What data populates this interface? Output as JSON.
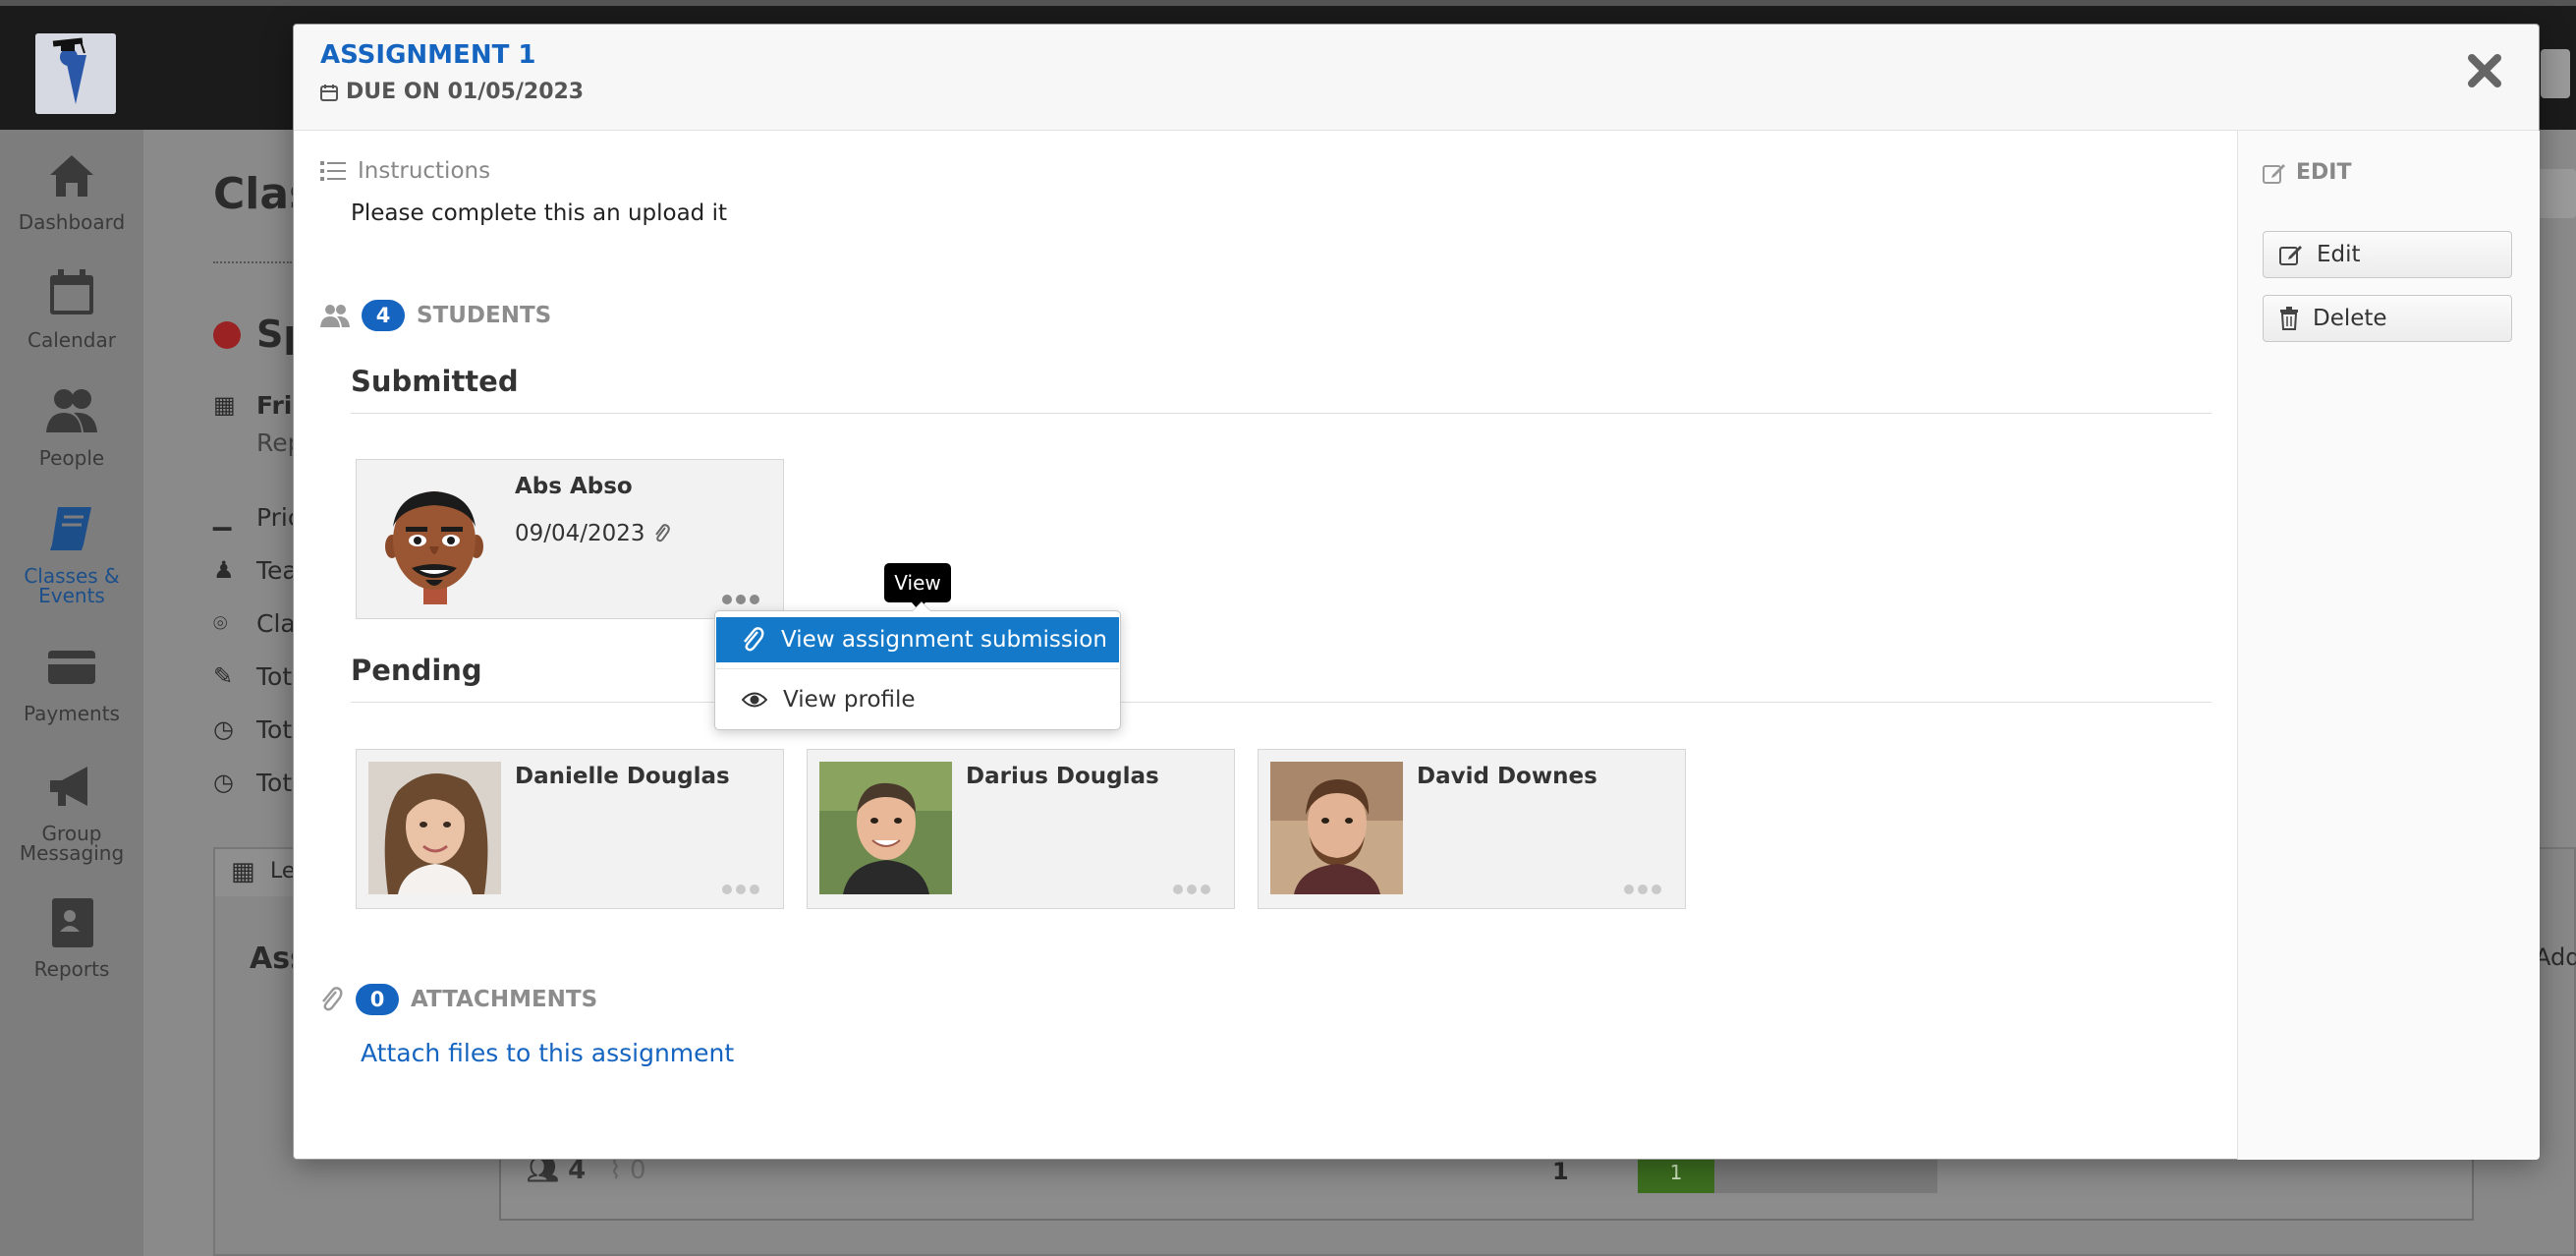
{
  "background": {
    "nav": [
      {
        "label": "Dashboard",
        "icon": "home-icon"
      },
      {
        "label": "Calendar",
        "icon": "calendar-icon"
      },
      {
        "label": "People",
        "icon": "people-icon"
      },
      {
        "label": "Classes & Events",
        "icon": "book-icon"
      },
      {
        "label": "Payments",
        "icon": "card-icon"
      },
      {
        "label": "Group Messaging",
        "icon": "megaphone-icon"
      },
      {
        "label": "Reports",
        "icon": "reports-icon"
      }
    ],
    "title_fragment": "Clas",
    "sp_fragment": "Sp",
    "date_fragment": "Frid",
    "rep_fragment": "Rep",
    "rows": [
      "Pric",
      "Tea",
      "Cla",
      "Tot",
      "Tot",
      "Tot"
    ],
    "tab_fragment": "Le",
    "ass_fragment": "Ass",
    "student_count": "4",
    "attach_count": "0",
    "lesson_count": "1",
    "bar_value": "1",
    "add_fragment": "Add"
  },
  "modal": {
    "title": "ASSIGNMENT 1",
    "due": "DUE ON 01/05/2023",
    "instructions_heading": "Instructions",
    "instructions_text": "Please complete this an upload it",
    "students_count": "4",
    "students_heading": "STUDENTS",
    "submitted_heading": "Submitted",
    "pending_heading": "Pending",
    "submitted": [
      {
        "name": "Abs Abso",
        "date": "09/04/2023"
      }
    ],
    "pending": [
      {
        "name": "Danielle Douglas"
      },
      {
        "name": "Darius Douglas"
      },
      {
        "name": "David Downes"
      }
    ],
    "tooltip": "View",
    "menu": {
      "view_submission": "View assignment submission",
      "view_profile": "View profile"
    },
    "attachments_count": "0",
    "attachments_heading": "ATTACHMENTS",
    "attach_link": "Attach files to this assignment",
    "side": {
      "heading": "EDIT",
      "edit": "Edit",
      "delete": "Delete"
    }
  },
  "colors": {
    "accent": "#1565c0",
    "menu_highlight": "#1479c8",
    "progress_green": "#3c6e1f"
  }
}
